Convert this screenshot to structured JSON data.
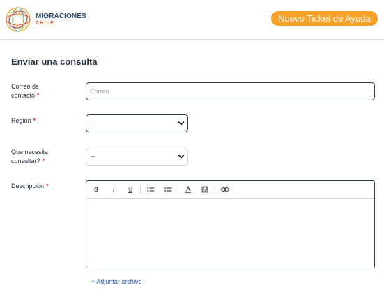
{
  "header": {
    "brand_main": "MIGRACIONES",
    "brand_sub": "CHILE",
    "ticket_button": "Nuevo Ticket de Ayuda"
  },
  "form": {
    "title": "Enviar una consulta",
    "email": {
      "label_line1": "Correo de",
      "label_line2": "contacto",
      "required": "*",
      "placeholder": "Correo",
      "value": ""
    },
    "region": {
      "label": "Región",
      "required": "*",
      "selected": "--"
    },
    "consulta": {
      "label_line1": "Que necesita",
      "label_line2": "consultar?",
      "required": "*",
      "selected": "--"
    },
    "descripcion": {
      "label": "Descripción",
      "required": "*",
      "toolbar": {
        "bold": "B",
        "italic": "I",
        "underline": "U"
      }
    },
    "attach": "+ Adjuntar archivo"
  },
  "colors": {
    "accent_orange": "#f7a128",
    "required_red": "#e53935",
    "link_blue": "#1e5bb8",
    "dark_border": "#2c3e50"
  }
}
